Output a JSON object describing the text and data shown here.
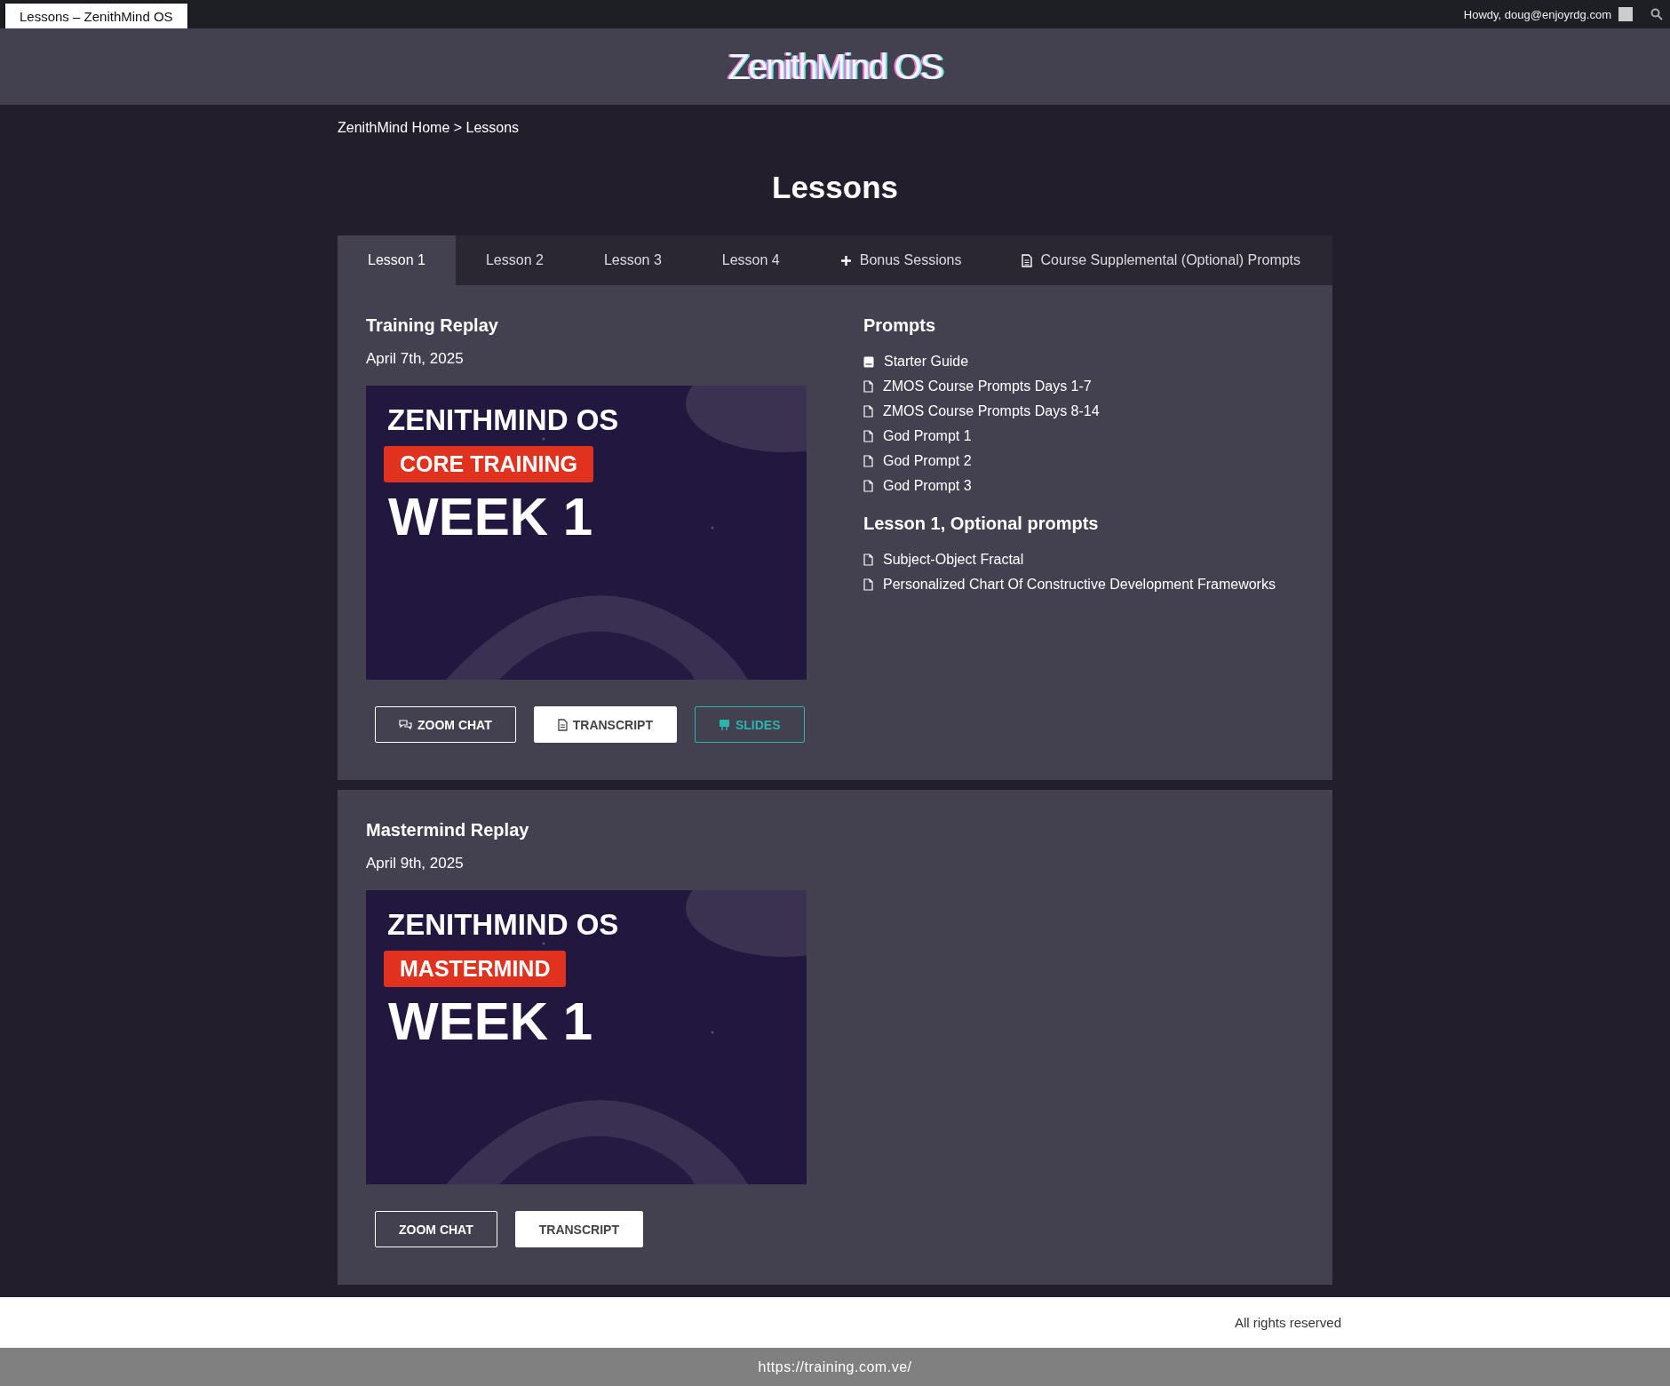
{
  "browser_tab": {
    "title": "Lessons – ZenithMind OS"
  },
  "admin_bar": {
    "greeting": "Howdy, doug@enjoyrdg.com"
  },
  "header": {
    "logo": "ZenithMind OS"
  },
  "breadcrumb": "ZenithMind Home > Lessons",
  "page_title": "Lessons",
  "tabs": [
    {
      "label": "Lesson 1",
      "selected": true,
      "kind": "plain"
    },
    {
      "label": "Lesson 2",
      "selected": false,
      "kind": "plain"
    },
    {
      "label": "Lesson 3",
      "selected": false,
      "kind": "plain"
    },
    {
      "label": "Lesson 4",
      "selected": false,
      "kind": "plain"
    },
    {
      "label": "Bonus Sessions",
      "selected": false,
      "kind": "plus"
    },
    {
      "label": "Course Supplemental (Optional) Prompts",
      "selected": false,
      "kind": "document"
    }
  ],
  "sections": [
    {
      "title": "Training Replay",
      "date": "April 7th, 2025",
      "thumbnail": {
        "brand": "ZENITHMIND OS",
        "tag": "CORE TRAINING",
        "week": "WEEK 1"
      },
      "buttons": [
        {
          "label": "ZOOM CHAT",
          "kind": "zoom-chat",
          "with_icon": true
        },
        {
          "label": "TRANSCRIPT",
          "kind": "transcript",
          "with_icon": true
        },
        {
          "label": "SLIDES",
          "kind": "slides",
          "with_icon": true
        }
      ],
      "prompt_groups": [
        {
          "title": "Prompts",
          "items": [
            {
              "label": "Starter Guide",
              "kind": "book"
            },
            {
              "label": "ZMOS Course Prompts Days 1-7",
              "kind": "file"
            },
            {
              "label": "ZMOS Course Prompts Days 8-14",
              "kind": "file"
            },
            {
              "label": "God Prompt 1",
              "kind": "file"
            },
            {
              "label": "God Prompt 2",
              "kind": "file"
            },
            {
              "label": "God Prompt 3",
              "kind": "file"
            }
          ]
        },
        {
          "title": "Lesson 1, Optional prompts",
          "items": [
            {
              "label": "Subject-Object Fractal",
              "kind": "file"
            },
            {
              "label": "Personalized Chart Of Constructive Development Frameworks",
              "kind": "file"
            }
          ]
        }
      ]
    },
    {
      "title": "Mastermind Replay",
      "date": "April 9th, 2025",
      "thumbnail": {
        "brand": "ZENITHMIND OS",
        "tag": "MASTERMIND",
        "week": "WEEK 1"
      },
      "buttons": [
        {
          "label": "ZOOM CHAT",
          "kind": "zoom-chat",
          "with_icon": false
        },
        {
          "label": "TRANSCRIPT",
          "kind": "transcript",
          "with_icon": false
        }
      ]
    }
  ],
  "footer": {
    "text": "All rights reserved"
  },
  "status_bar": {
    "url": "https://training.com.ve/"
  }
}
